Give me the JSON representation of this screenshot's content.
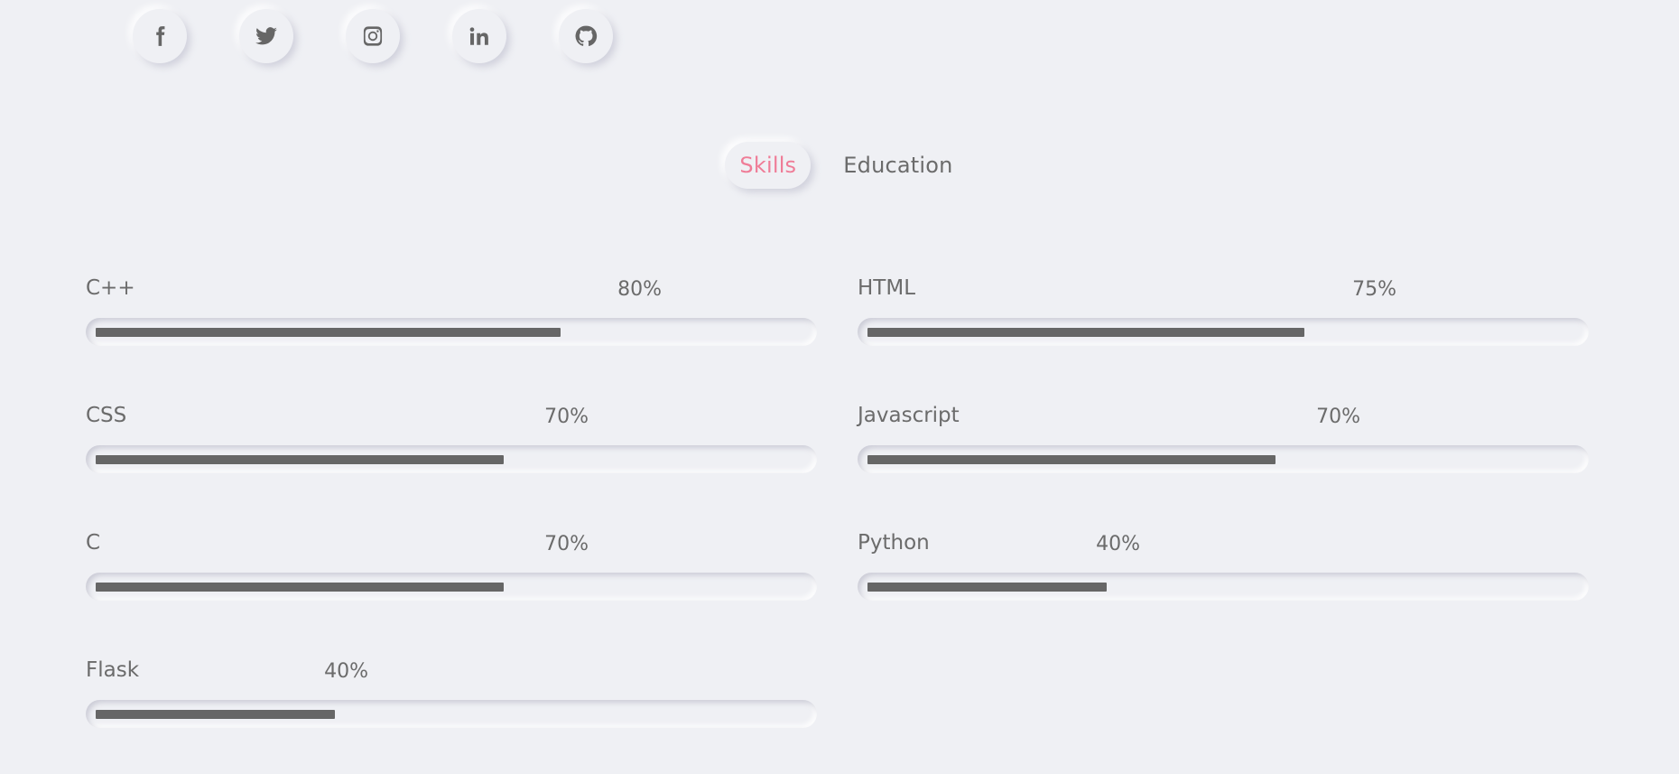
{
  "social": [
    {
      "name": "facebook-icon"
    },
    {
      "name": "twitter-icon"
    },
    {
      "name": "instagram-icon"
    },
    {
      "name": "linkedin-icon"
    },
    {
      "name": "github-icon"
    }
  ],
  "tabs": [
    {
      "label": "Skills",
      "active": true
    },
    {
      "label": "Education",
      "active": false
    }
  ],
  "colors": {
    "background": "#eff0f4",
    "accent": "#ef7c97",
    "bar": "#666666",
    "text": "#666666"
  },
  "skills": [
    {
      "name": "C++",
      "percent_label": "80%",
      "level": 80
    },
    {
      "name": "HTML",
      "percent_label": "75%",
      "level": 75
    },
    {
      "name": "CSS",
      "percent_label": "70%",
      "level": 70
    },
    {
      "name": "Javascript",
      "percent_label": "70%",
      "level": 70
    },
    {
      "name": "C",
      "percent_label": "70%",
      "level": 70
    },
    {
      "name": "Python",
      "percent_label": "40%",
      "level": 40
    },
    {
      "name": "Flask",
      "percent_label": "40%",
      "level": 40
    }
  ]
}
